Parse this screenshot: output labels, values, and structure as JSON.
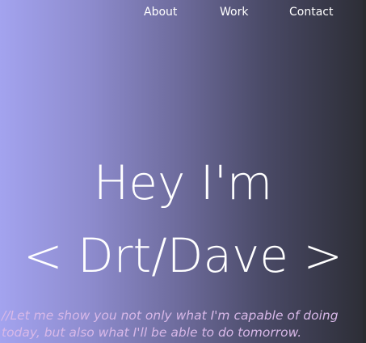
{
  "nav": {
    "about": "About",
    "work": "Work",
    "contact": "Contact"
  },
  "hero": {
    "line1": "Hey I'm",
    "line2": "< Drt/Dave >"
  },
  "tagline": {
    "line1": "//Let me show you not only what I'm capable of doing",
    "line2": "today, but also what I'll be able to do tomorrow."
  },
  "colors": {
    "gradient_start": "#a3a3ef",
    "gradient_end": "#2c2d35",
    "text": "#ffffff",
    "tagline": "#d8b8e8"
  }
}
